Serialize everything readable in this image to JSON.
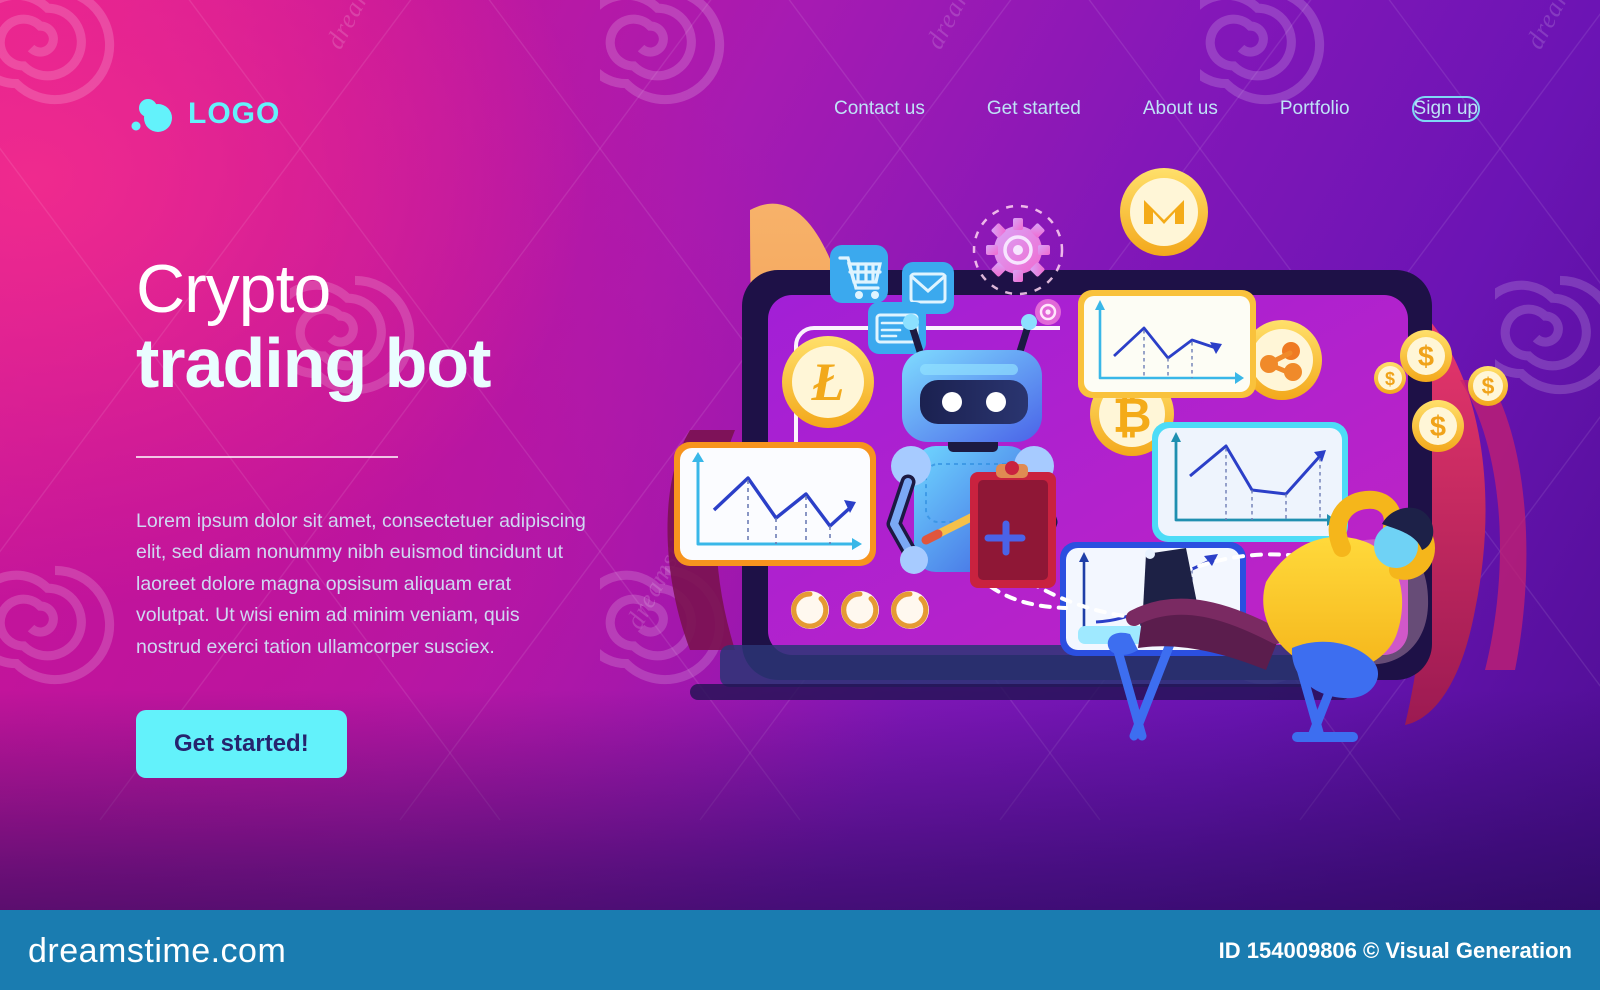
{
  "header": {
    "logo_text": "LOGO",
    "logo_icon": "dot-circle-logo-icon",
    "nav": [
      {
        "label": "Contact us",
        "name": "nav-contact-us"
      },
      {
        "label": "Get started",
        "name": "nav-get-started"
      },
      {
        "label": "About us",
        "name": "nav-about-us"
      },
      {
        "label": "Portfolio",
        "name": "nav-portfolio"
      }
    ],
    "signup_label": "Sign up"
  },
  "hero": {
    "title_line1": "Crypto",
    "title_line2": "trading bot",
    "paragraph": "Lorem ipsum dolor sit amet, consectetuer adipiscing elit, sed diam nonummy nibh euismod tincidunt ut laoreet dolore magna opsisum aliquam erat volutpat. Ut wisi enim ad minim veniam, quis nostrud exerci tation ullamcorper susciex.",
    "cta_label": "Get started!"
  },
  "illustration": {
    "alt": "Crypto trading bot illustration",
    "coins": [
      {
        "symbol": "Ł",
        "name": "litecoin-coin"
      },
      {
        "symbol": "Μ",
        "name": "monero-coin"
      },
      {
        "symbol": "₿",
        "name": "bitcoin-coin"
      },
      {
        "symbol": "ripple",
        "name": "ripple-coin"
      },
      {
        "symbol": "$",
        "name": "dollar-coin-1"
      },
      {
        "symbol": "$",
        "name": "dollar-coin-2"
      },
      {
        "symbol": "$",
        "name": "dollar-coin-3"
      },
      {
        "symbol": "$",
        "name": "dollar-coin-4"
      }
    ],
    "app_icons": [
      "shopping-cart-icon",
      "mail-envelope-icon",
      "card-list-icon",
      "gear-icon",
      "small-gear-icon"
    ],
    "charts": [
      {
        "name": "chart-card-left",
        "accent": "#f7941e"
      },
      {
        "name": "chart-card-top-right",
        "accent": "#f9c23c"
      },
      {
        "name": "chart-card-mid-right",
        "accent": "#4ddcf7"
      },
      {
        "name": "chart-card-bottom",
        "accent": "#ffffff"
      }
    ],
    "progress_rings": 3,
    "robot": "trading-robot",
    "person": "relaxing-trader-person",
    "desk": "desk-with-laptop"
  },
  "footer": {
    "site": "dreamstime.com",
    "credit": "ID 154009806 © Visual Generation"
  },
  "colors": {
    "accent_cyan": "#63f2fb",
    "bg_pink": "#e8208f",
    "bg_purple": "#4a0d8f",
    "footer_blue": "#1a7cb0",
    "cta_text": "#26246e",
    "gold": "#f6b31c"
  }
}
